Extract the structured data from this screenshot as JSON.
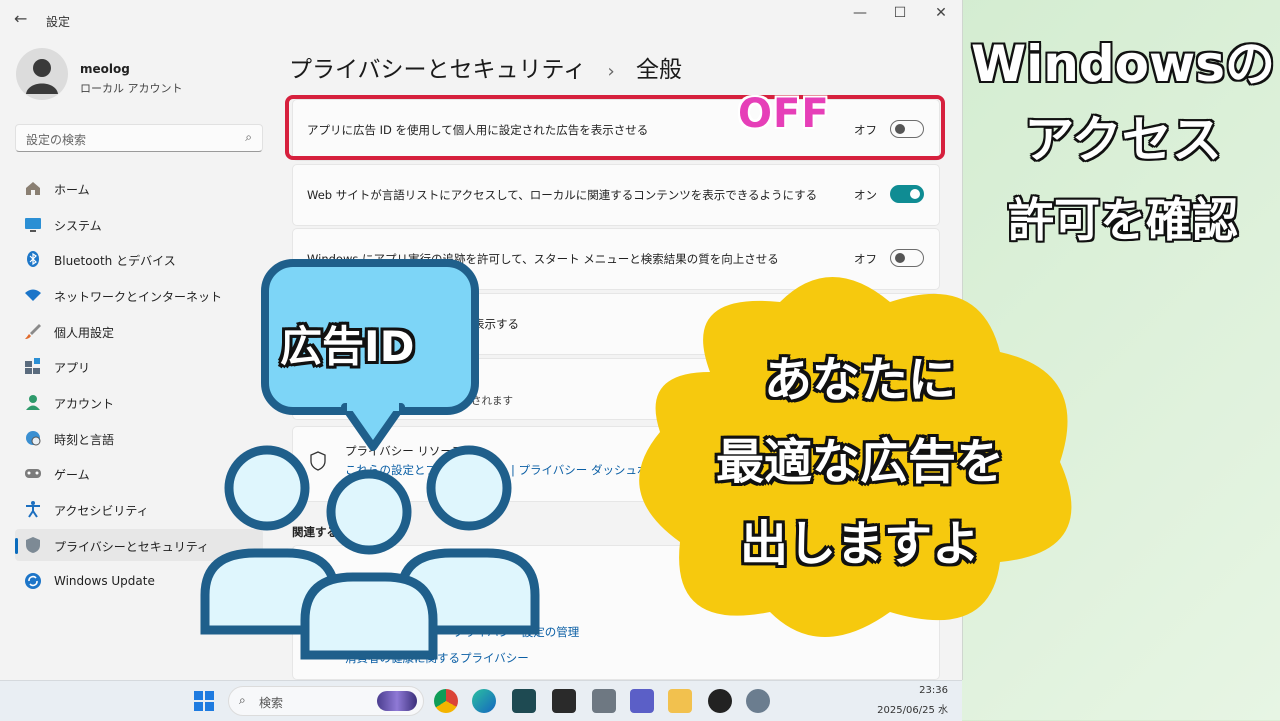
{
  "window": {
    "title": "設定",
    "back": "←",
    "minimize": "—",
    "maximize": "☐",
    "close": "✕"
  },
  "profile": {
    "name": "meolog",
    "account_type": "ローカル アカウント"
  },
  "search": {
    "placeholder": "設定の検索"
  },
  "nav": [
    {
      "label": "ホーム",
      "icon": "home-icon"
    },
    {
      "label": "システム",
      "icon": "system-icon"
    },
    {
      "label": "Bluetooth とデバイス",
      "icon": "bluetooth-icon"
    },
    {
      "label": "ネットワークとインターネット",
      "icon": "wifi-icon"
    },
    {
      "label": "個人用設定",
      "icon": "brush-icon"
    },
    {
      "label": "アプリ",
      "icon": "apps-icon"
    },
    {
      "label": "アカウント",
      "icon": "account-icon"
    },
    {
      "label": "時刻と言語",
      "icon": "globe-icon"
    },
    {
      "label": "ゲーム",
      "icon": "gamepad-icon"
    },
    {
      "label": "アクセシビリティ",
      "icon": "accessibility-icon"
    },
    {
      "label": "プライバシーとセキュリティ",
      "icon": "shield-icon",
      "active": true
    },
    {
      "label": "Windows Update",
      "icon": "update-icon"
    }
  ],
  "header": {
    "parent": "プライバシーとセキュリティ",
    "separator": "›",
    "current": "全般"
  },
  "settings": [
    {
      "text": "アプリに広告 ID を使用して個人用に設定された広告を表示させる",
      "state": "オフ",
      "on": false
    },
    {
      "text": "Web サイトが言語リストにアクセスして、ローカルに関連するコンテンツを表示できるようにする",
      "state": "オン",
      "on": true
    },
    {
      "text": "Windows にアプリ実行の追跡を許可して、スタート メニューと検索結果の質を向上させる",
      "state": "オフ",
      "on": false
    },
    {
      "text": "表示する"
    }
  ],
  "fragments": {
    "row5": "されます",
    "privacy_resources": "プライバシー リソース",
    "privacy_links_prefix": "これらの設定とプラ",
    "privacy_links_suffix": "| プライバシー ダッシュボ",
    "related": "関連する",
    "link_manage": "プライバシー設定の管理",
    "link_health": "消費者の健康に関するプライバシー"
  },
  "taskbar": {
    "search_label": "検索",
    "time": "23:36",
    "date": "2025/06/25 水"
  },
  "overlay": {
    "off": "OFF",
    "title_lines": [
      "Windowsの",
      "アクセス",
      "許可を確認"
    ],
    "bubble": "広告ID",
    "cloud_lines": [
      "あなたに",
      "最適な広告を",
      "出しますよ"
    ]
  },
  "colors": {
    "accent": "#0f8c93",
    "highlight": "#d6203d",
    "off_text": "#e63fb8",
    "cloud": "#f6c90e",
    "bubble": "#7dd5f7",
    "people": "#1f5f8b"
  }
}
